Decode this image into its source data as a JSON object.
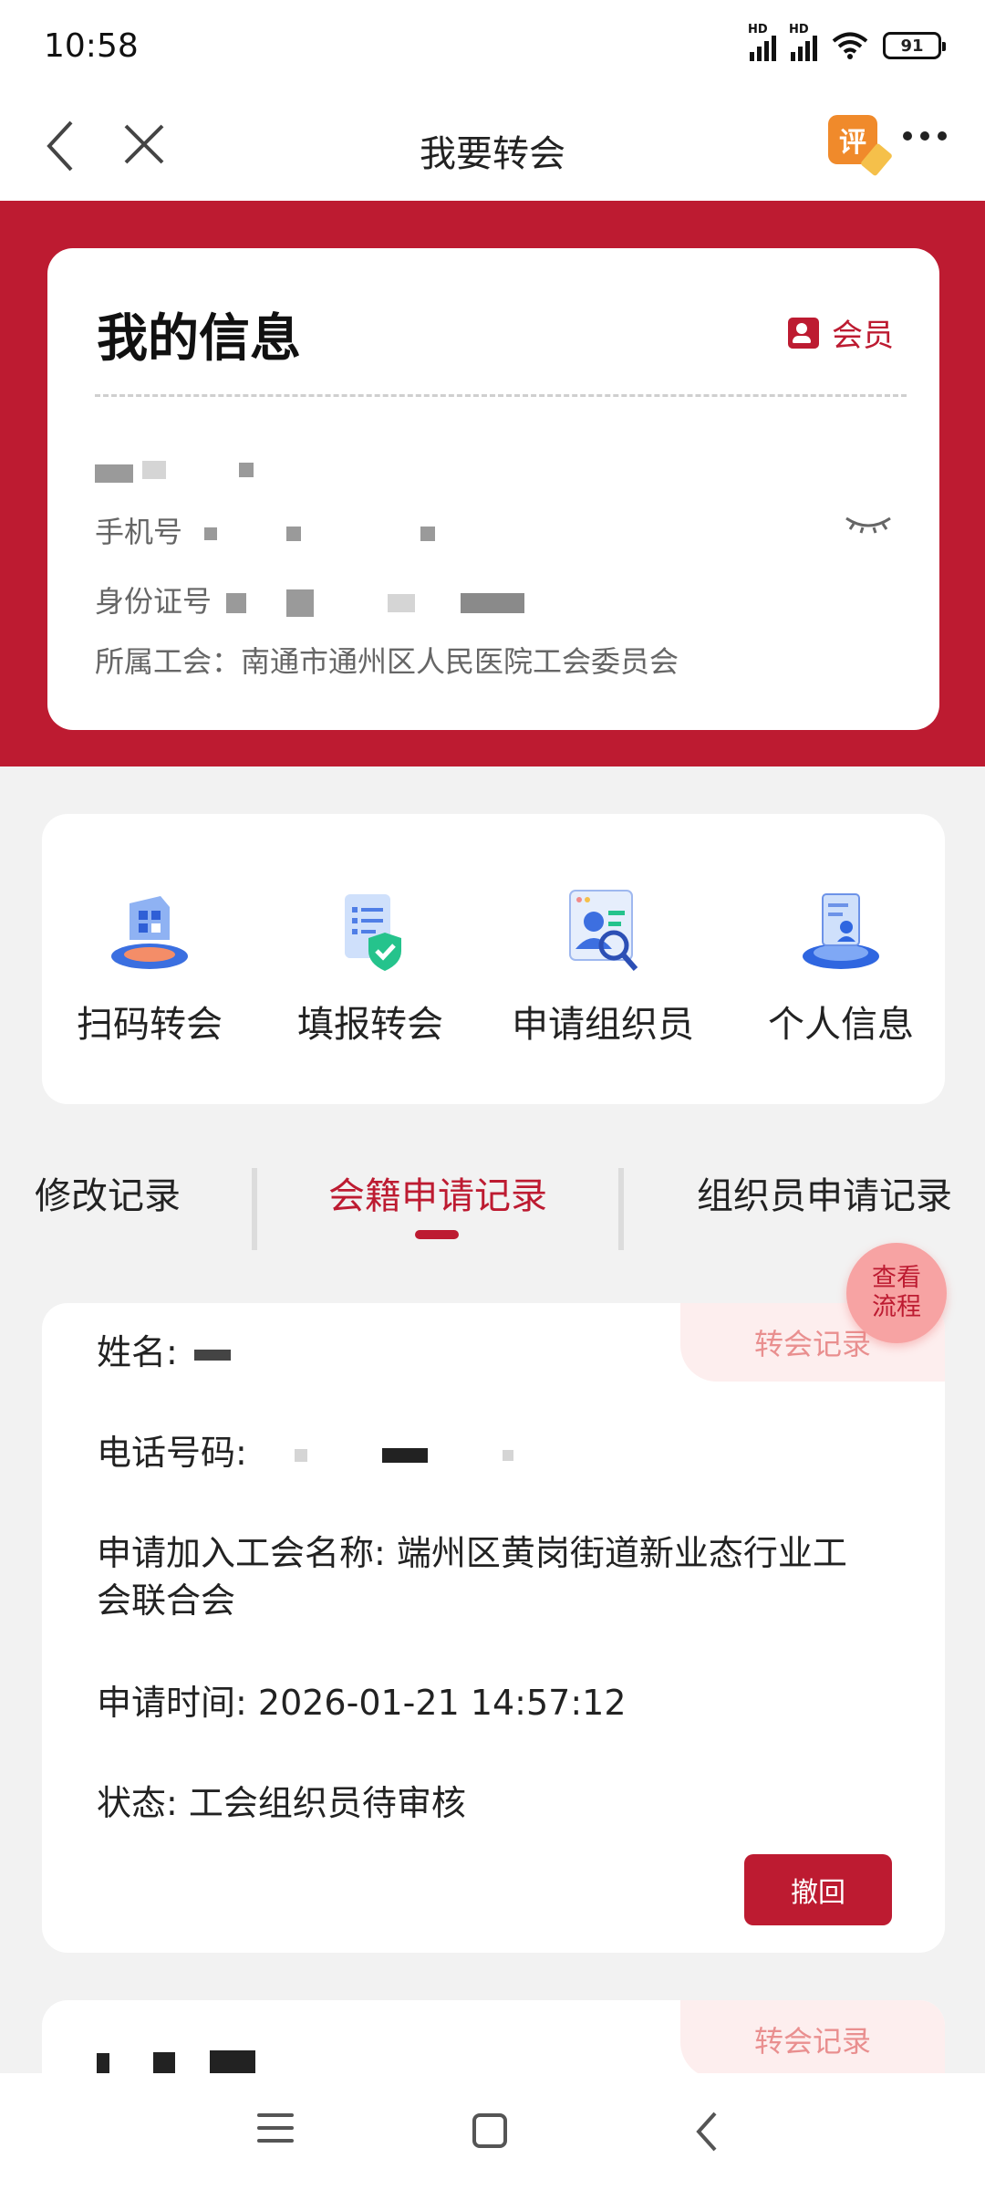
{
  "status_bar": {
    "time": "10:58",
    "battery": "91",
    "hd1": "HD",
    "hd2": "HD"
  },
  "nav": {
    "title": "我要转会",
    "rate_icon_char": "评"
  },
  "info_card": {
    "title": "我的信息",
    "member_label": "会员",
    "phone_label": "手机号",
    "id_label": "身份证号",
    "union_label": "所属工会：",
    "union_value": "南通市通州区人民医院工会委员会"
  },
  "actions": [
    {
      "label": "扫码转会",
      "icon": "qr-scan-icon"
    },
    {
      "label": "填报转会",
      "icon": "form-shield-icon"
    },
    {
      "label": "申请组织员",
      "icon": "person-search-icon"
    },
    {
      "label": "个人信息",
      "icon": "profile-doc-icon"
    }
  ],
  "tabs": [
    {
      "label": "修改记录"
    },
    {
      "label": "会籍申请记录",
      "active": true
    },
    {
      "label": "组织员申请记录"
    }
  ],
  "flow_button": {
    "line1": "查看",
    "line2": "流程"
  },
  "records": [
    {
      "tag": "转会记录",
      "name_label": "姓名:",
      "phone_label": "电话号码:",
      "union_label": "申请加入工会名称:",
      "union_value_line1": "端州区黄岗街道新业态行业工",
      "union_value_line2": "会联合会",
      "time_label": "申请时间:",
      "time_value": "2026-01-21 14:57:12",
      "status_label": "状态:",
      "status_value": "工会组织员待审核",
      "withdraw_label": "撤回"
    },
    {
      "tag": "转会记录"
    }
  ],
  "colors": {
    "brand_red": "#bd1b31",
    "tag_bg": "#fdeeee",
    "tag_text": "#e98f8f"
  }
}
